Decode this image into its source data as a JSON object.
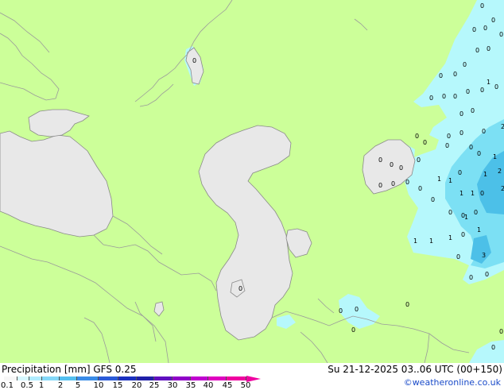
{
  "map": {
    "land_color": "#ccff99",
    "water_color": "#e8e8e8",
    "border_color": "#999999",
    "coast_color": "#777777",
    "precip_light": "#b6f8fc",
    "precip_medium": "#7ce0f4",
    "precip_heavy": "#4cc0e8",
    "value_labels": [
      "0",
      "0",
      "0",
      "0",
      "0",
      "0",
      "0",
      "0",
      "0",
      "0",
      "0",
      "0",
      "0",
      "0",
      "0",
      "0",
      "0",
      "0",
      "0",
      "0",
      "0",
      "0",
      "0",
      "0",
      "0",
      "0",
      "0",
      "0",
      "0",
      "0",
      "1",
      "1",
      "1",
      "1",
      "1",
      "1",
      "1",
      "1",
      "1",
      "1",
      "1",
      "1",
      "2",
      "2",
      "2",
      "3",
      "0",
      "0",
      "0",
      "0",
      "0",
      "0",
      "0",
      "0",
      "0",
      "0",
      "0",
      "0",
      "0",
      "0",
      "0",
      "0",
      "0",
      "0",
      "0",
      "0",
      "0",
      "0"
    ]
  },
  "footer": {
    "title": "Precipitation [mm]  GFS 0.25",
    "datetime": "Su 21-12-2025 03..06 UTC (00+150)",
    "credit": "©weatheronline.co.uk",
    "scale_labels": [
      "0.1",
      "0.5",
      "1",
      "2",
      "5",
      "10",
      "15",
      "20",
      "25",
      "30",
      "35",
      "40",
      "45",
      "50"
    ],
    "scale_colors": [
      "#f7f7f7",
      "#d6f7ff",
      "#b0ecff",
      "#84d8f8",
      "#54c0f0",
      "#3a8ce8",
      "#2a5ad8",
      "#1a30c0",
      "#2020a8",
      "#6010c0",
      "#9000c8",
      "#c000d0",
      "#e000c0",
      "#f000a0"
    ]
  }
}
